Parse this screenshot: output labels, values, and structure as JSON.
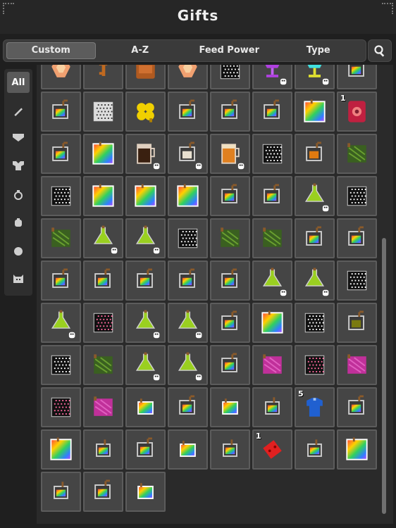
{
  "title": "Gifts",
  "tabs": [
    {
      "label": "Custom",
      "active": true
    },
    {
      "label": "A-Z",
      "active": false
    },
    {
      "label": "Feed Power",
      "active": false
    },
    {
      "label": "Type",
      "active": false
    }
  ],
  "search": {
    "icon": "search-icon"
  },
  "categories": [
    {
      "label": "All",
      "icon": "",
      "active": true
    },
    {
      "label": "",
      "icon": "sword-icon",
      "active": false
    },
    {
      "label": "",
      "icon": "armor-icon",
      "active": false
    },
    {
      "label": "",
      "icon": "chest-armor-icon",
      "active": false
    },
    {
      "label": "",
      "icon": "ring-icon",
      "active": false
    },
    {
      "label": "",
      "icon": "food-icon",
      "active": false
    },
    {
      "label": "",
      "icon": "orb-icon",
      "active": false
    },
    {
      "label": "",
      "icon": "cat-icon",
      "active": false
    }
  ],
  "items": [
    {
      "kind": "gem"
    },
    {
      "kind": "key"
    },
    {
      "kind": "backpack"
    },
    {
      "kind": "gem"
    },
    {
      "kind": "dots-black"
    },
    {
      "kind": "goblet-purple",
      "flag": true
    },
    {
      "kind": "goblet-cyan",
      "flag": true
    },
    {
      "kind": "pot-rainbow"
    },
    {
      "kind": "pot-rainbow"
    },
    {
      "kind": "dots-white"
    },
    {
      "kind": "clover"
    },
    {
      "kind": "pot-rainbow"
    },
    {
      "kind": "pot-rainbow"
    },
    {
      "kind": "pot-rainbow"
    },
    {
      "kind": "card-rainbow"
    },
    {
      "kind": "book-red",
      "count": "1"
    },
    {
      "kind": "pot-rainbow"
    },
    {
      "kind": "card-rainbow"
    },
    {
      "kind": "mug-dark",
      "flag": true
    },
    {
      "kind": "pot-white",
      "flag": true
    },
    {
      "kind": "mug-orange",
      "flag": true
    },
    {
      "kind": "dots-black"
    },
    {
      "kind": "pot-orange"
    },
    {
      "kind": "green-bag"
    },
    {
      "kind": "dots-black"
    },
    {
      "kind": "card-rainbow"
    },
    {
      "kind": "card-rainbow"
    },
    {
      "kind": "card-rainbow"
    },
    {
      "kind": "pot-rainbow"
    },
    {
      "kind": "pot-rainbow"
    },
    {
      "kind": "flask-green",
      "flag": true
    },
    {
      "kind": "dots-black"
    },
    {
      "kind": "green-bag"
    },
    {
      "kind": "flask-green",
      "flag": true
    },
    {
      "kind": "flask-green",
      "flag": true
    },
    {
      "kind": "dots-black"
    },
    {
      "kind": "green-bag"
    },
    {
      "kind": "green-bag"
    },
    {
      "kind": "pot-rainbow"
    },
    {
      "kind": "pot-rainbow"
    },
    {
      "kind": "pot-rainbow"
    },
    {
      "kind": "pot-rainbow"
    },
    {
      "kind": "pot-rainbow"
    },
    {
      "kind": "pot-rainbow"
    },
    {
      "kind": "pot-rainbow"
    },
    {
      "kind": "flask-green",
      "flag": true
    },
    {
      "kind": "flask-green",
      "flag": true
    },
    {
      "kind": "dots-black"
    },
    {
      "kind": "flask-green",
      "flag": true
    },
    {
      "kind": "dots-pink"
    },
    {
      "kind": "flask-green",
      "flag": true
    },
    {
      "kind": "flask-green",
      "flag": true
    },
    {
      "kind": "pot-rainbow"
    },
    {
      "kind": "card-rainbow"
    },
    {
      "kind": "dots-black"
    },
    {
      "kind": "pot-olive"
    },
    {
      "kind": "dots-black"
    },
    {
      "kind": "green-bag"
    },
    {
      "kind": "flask-green",
      "flag": true
    },
    {
      "kind": "flask-green",
      "flag": true
    },
    {
      "kind": "pot-rainbow"
    },
    {
      "kind": "pink-bag"
    },
    {
      "kind": "dots-pink"
    },
    {
      "kind": "pink-bag"
    },
    {
      "kind": "dots-pink"
    },
    {
      "kind": "pink-bag"
    },
    {
      "kind": "card-small"
    },
    {
      "kind": "pot-rainbow"
    },
    {
      "kind": "card-small"
    },
    {
      "kind": "pot-small"
    },
    {
      "kind": "blue-shirt",
      "count": "5"
    },
    {
      "kind": "pot-rainbow"
    },
    {
      "kind": "card-rainbow"
    },
    {
      "kind": "pot-small"
    },
    {
      "kind": "pot-rainbow"
    },
    {
      "kind": "card-small"
    },
    {
      "kind": "pot-small"
    },
    {
      "kind": "red-ticket",
      "count": "1"
    },
    {
      "kind": "pot-small"
    },
    {
      "kind": "card-rainbow"
    },
    {
      "kind": "pot-small"
    },
    {
      "kind": "pot-rainbow"
    },
    {
      "kind": "card-small"
    }
  ]
}
